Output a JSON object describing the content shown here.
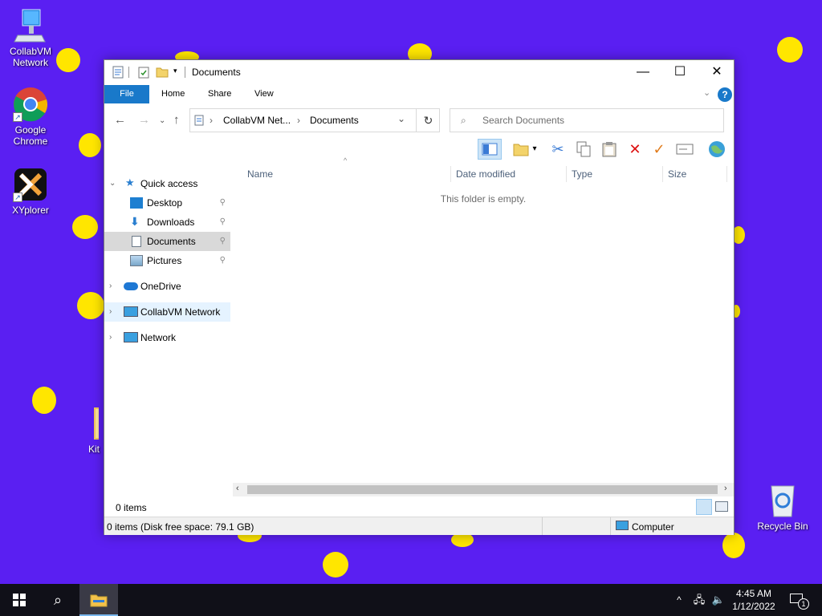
{
  "desktop": {
    "icons": [
      {
        "name": "collabvm-network",
        "label": "CollabVM\nNetwork"
      },
      {
        "name": "google-chrome",
        "label": "Google\nChrome"
      },
      {
        "name": "xyplorer",
        "label": "XYplorer"
      },
      {
        "name": "kit-folder",
        "label": "Kit"
      },
      {
        "name": "recycle-bin",
        "label": "Recycle Bin"
      }
    ]
  },
  "window": {
    "title": "Documents",
    "ribbon_tabs": [
      "File",
      "Home",
      "Share",
      "View"
    ],
    "breadcrumb": [
      "CollabVM Net...",
      "Documents"
    ],
    "search_placeholder": "Search Documents",
    "columns": [
      "Name",
      "Date modified",
      "Type",
      "Size"
    ],
    "empty_message": "This folder is empty.",
    "nav": {
      "quick_access": "Quick access",
      "items": [
        "Desktop",
        "Downloads",
        "Documents",
        "Pictures"
      ],
      "onedrive": "OneDrive",
      "collabvm": "CollabVM Network",
      "network": "Network"
    },
    "item_count": "0 items",
    "status_left": "0 items (Disk free space: 79.1 GB)",
    "status_right": "Computer"
  },
  "taskbar": {
    "time": "4:45 AM",
    "date": "1/12/2022",
    "notification_count": "1"
  },
  "colors": {
    "desktop_bg": "#5a1ff2",
    "dot": "#ffe600",
    "accent": "#1979ca"
  }
}
